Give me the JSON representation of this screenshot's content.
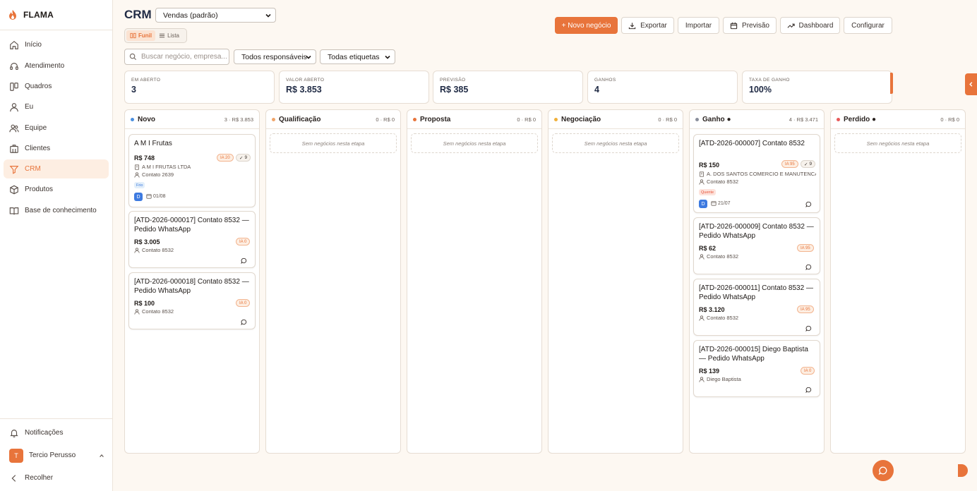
{
  "brand": {
    "name": "FLAMA",
    "accent": "#e8743b"
  },
  "sidebar": {
    "items": [
      {
        "label": "Início",
        "icon": "home-icon"
      },
      {
        "label": "Atendimento",
        "icon": "headset-icon"
      },
      {
        "label": "Quadros",
        "icon": "board-icon"
      },
      {
        "label": "Eu",
        "icon": "user-icon"
      },
      {
        "label": "Equipe",
        "icon": "users-icon"
      },
      {
        "label": "Clientes",
        "icon": "building-icon"
      },
      {
        "label": "CRM",
        "icon": "funnel-icon",
        "active": true
      },
      {
        "label": "Produtos",
        "icon": "box-icon"
      },
      {
        "label": "Base de conhecimento",
        "icon": "book-icon"
      }
    ],
    "notifications": "Notificações",
    "user": {
      "initial": "T",
      "name": "Tercio Perusso"
    },
    "collapse": "Recolher"
  },
  "header": {
    "title": "CRM",
    "pipeline": "Vendas (padrão)",
    "views": {
      "funnel": "Funil",
      "list": "Lista"
    },
    "buttons": {
      "new": "+ Novo negócio",
      "export": "Exportar",
      "import": "Importar",
      "forecast": "Previsão",
      "dashboard": "Dashboard",
      "configure": "Configurar"
    }
  },
  "filters": {
    "search_placeholder": "Buscar negócio, empresa...",
    "owners": "Todos responsáveis",
    "tags": "Todas etiquetas"
  },
  "stats": [
    {
      "label": "EM ABERTO",
      "value": "3"
    },
    {
      "label": "VALOR ABERTO",
      "value": "R$ 3.853"
    },
    {
      "label": "PREVISÃO",
      "value": "R$ 385"
    },
    {
      "label": "GANHOS",
      "value": "4"
    },
    {
      "label": "TAXA DE GANHO",
      "value": "100%"
    }
  ],
  "empty_text": "Sem negócios nesta etapa",
  "columns": [
    {
      "name": "Novo",
      "summary": "3 · R$ 3.853",
      "color": "#4a8fe0",
      "cards": [
        {
          "title": "A M I Frutas",
          "value": "R$ 748",
          "ia": "IA 20",
          "tasks": "9",
          "company": "A M I FRUTAS LTDA",
          "contact": "Contato 2639",
          "tag": "Frio",
          "user": "D",
          "date": "01/08"
        },
        {
          "title": "[ATD-2026-000017] Contato 8532 — Pedido WhatsApp",
          "value": "R$ 3.005",
          "ia": "IA 0",
          "contact": "Contato 8532"
        },
        {
          "title": "[ATD-2026-000018] Contato 8532 — Pedido WhatsApp",
          "value": "R$ 100",
          "ia": "IA 0",
          "contact": "Contato 8532"
        }
      ]
    },
    {
      "name": "Qualificação",
      "summary": "0 · R$ 0",
      "color": "#f0a56a",
      "cards": []
    },
    {
      "name": "Proposta",
      "summary": "0 · R$ 0",
      "color": "#e8743b",
      "cards": []
    },
    {
      "name": "Negociação",
      "summary": "0 · R$ 0",
      "color": "#f0b03a",
      "cards": []
    },
    {
      "name": "Ganho ●",
      "summary": "4 · R$ 3.471",
      "color": "#8a8f9c",
      "cards": [
        {
          "title": "[ATD-2026-000007] Contato 8532",
          "value": "R$ 150",
          "ia": "IA 95",
          "tasks": "9",
          "company": "A. DOS SANTOS COMERCIO E MANUTENCAO",
          "contact": "Contato 8532",
          "tag": "Quente",
          "user": "D",
          "date": "21/07"
        },
        {
          "title": "[ATD-2026-000009] Contato 8532 — Pedido WhatsApp",
          "value": "R$ 62",
          "ia": "IA 95",
          "contact": "Contato 8532"
        },
        {
          "title": "[ATD-2026-000011] Contato 8532 — Pedido WhatsApp",
          "value": "R$ 3.120",
          "ia": "IA 95",
          "contact": "Contato 8532"
        },
        {
          "title": "[ATD-2026-000015] Diego Baptista — Pedido WhatsApp",
          "value": "R$ 139",
          "ia": "IA 0",
          "contact": "Diego Baptista"
        }
      ]
    },
    {
      "name": "Perdido ●",
      "summary": "0 · R$ 0",
      "color": "#e85a5a",
      "cards": []
    }
  ]
}
